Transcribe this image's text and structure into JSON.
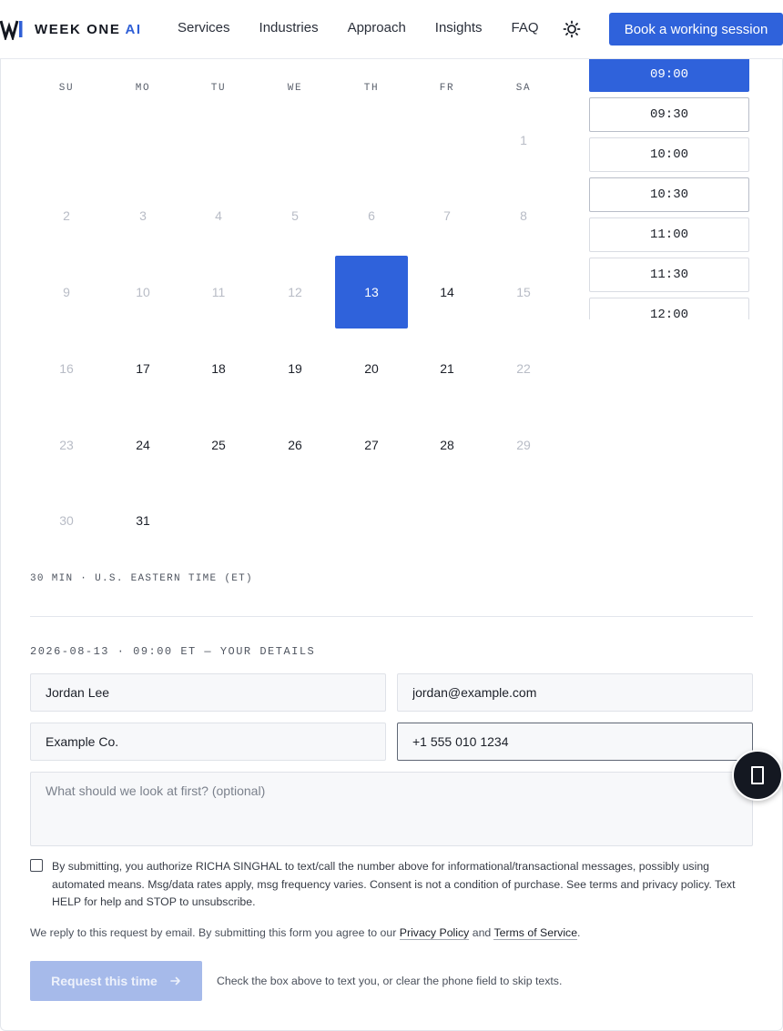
{
  "header": {
    "brand": "WEEK ONE",
    "brand_accent": "AI",
    "nav": [
      "Services",
      "Industries",
      "Approach",
      "Insights",
      "FAQ"
    ],
    "cta_label": "Book a working session"
  },
  "calendar": {
    "weekdays": [
      "SU",
      "MO",
      "TU",
      "WE",
      "TH",
      "FR",
      "SA"
    ],
    "selected_day": 13,
    "days": [
      {
        "label": "1",
        "state": "muted"
      },
      {
        "label": "2",
        "state": "muted"
      },
      {
        "label": "3",
        "state": "muted"
      },
      {
        "label": "4",
        "state": "muted"
      },
      {
        "label": "5",
        "state": "muted"
      },
      {
        "label": "6",
        "state": "muted"
      },
      {
        "label": "7",
        "state": "muted"
      },
      {
        "label": "8",
        "state": "muted"
      },
      {
        "label": "9",
        "state": "muted"
      },
      {
        "label": "10",
        "state": "muted"
      },
      {
        "label": "11",
        "state": "muted"
      },
      {
        "label": "12",
        "state": "muted"
      },
      {
        "label": "13",
        "state": "selected"
      },
      {
        "label": "14",
        "state": "available"
      },
      {
        "label": "15",
        "state": "muted"
      },
      {
        "label": "16",
        "state": "muted"
      },
      {
        "label": "17",
        "state": "available"
      },
      {
        "label": "18",
        "state": "available"
      },
      {
        "label": "19",
        "state": "available"
      },
      {
        "label": "20",
        "state": "available"
      },
      {
        "label": "21",
        "state": "available"
      },
      {
        "label": "22",
        "state": "muted"
      },
      {
        "label": "23",
        "state": "muted"
      },
      {
        "label": "24",
        "state": "available"
      },
      {
        "label": "25",
        "state": "available"
      },
      {
        "label": "26",
        "state": "available"
      },
      {
        "label": "27",
        "state": "available"
      },
      {
        "label": "28",
        "state": "available"
      },
      {
        "label": "29",
        "state": "muted"
      },
      {
        "label": "30",
        "state": "muted"
      },
      {
        "label": "31",
        "state": "available"
      }
    ],
    "timezone_note": "30 MIN · U.S. EASTERN TIME (ET)"
  },
  "time_slots": [
    {
      "label": "09:00",
      "state": "selected"
    },
    {
      "label": "09:30",
      "state": "highlight"
    },
    {
      "label": "10:00",
      "state": "default"
    },
    {
      "label": "10:30",
      "state": "highlight"
    },
    {
      "label": "11:00",
      "state": "default"
    },
    {
      "label": "11:30",
      "state": "default"
    },
    {
      "label": "12:00",
      "state": "default"
    }
  ],
  "form": {
    "section_heading": "2026-08-13 · 09:00 ET — YOUR DETAILS",
    "name_value": "Jordan Lee",
    "email_value": "jordan@example.com",
    "company_value": "Example Co.",
    "phone_value": "+1 555 010 1234",
    "notes_placeholder": "What should we look at first? (optional)",
    "consent_text": "By submitting, you authorize RICHA SINGHAL to text/call the number above for informational/transactional messages, possibly using automated means. Msg/data rates apply, msg frequency varies. Consent is not a condition of purchase. See terms and privacy policy. Text HELP for help and STOP to unsubscribe.",
    "legal_prefix": "We reply to this request by email. By submitting this form you agree to our",
    "privacy_link": "Privacy Policy",
    "legal_and": "and",
    "terms_link": "Terms of Service",
    "legal_suffix": ".",
    "submit_label": "Request this time",
    "hint": "Check the box above to text you, or clear the phone field to skip texts."
  },
  "colors": {
    "accent": "#2f62db",
    "accent_disabled": "#a6baea",
    "muted_text": "#b8bcc6"
  },
  "icons": {
    "theme": "sun-icon",
    "submit": "arrow-right-icon",
    "chat": "chat-widget-icon"
  }
}
